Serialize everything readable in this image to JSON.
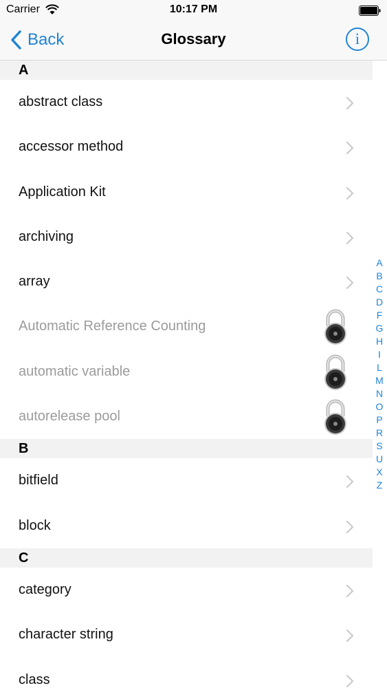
{
  "status_bar": {
    "carrier": "Carrier",
    "time": "10:17 PM"
  },
  "nav": {
    "back_label": "Back",
    "title": "Glossary",
    "info_glyph": "i"
  },
  "colors": {
    "accent": "#1f84d6",
    "locked_text": "#9b9b9b",
    "section_bg": "#f2f2f2"
  },
  "sections": [
    {
      "letter": "A",
      "items": [
        {
          "label": "abstract class",
          "locked": false
        },
        {
          "label": "accessor method",
          "locked": false
        },
        {
          "label": "Application Kit",
          "locked": false
        },
        {
          "label": "archiving",
          "locked": false
        },
        {
          "label": "array",
          "locked": false
        },
        {
          "label": "Automatic Reference Counting",
          "locked": true
        },
        {
          "label": "automatic variable",
          "locked": true
        },
        {
          "label": "autorelease pool",
          "locked": true
        }
      ]
    },
    {
      "letter": "B",
      "items": [
        {
          "label": "bitfield",
          "locked": false
        },
        {
          "label": "block",
          "locked": false
        }
      ]
    },
    {
      "letter": "C",
      "items": [
        {
          "label": "category",
          "locked": false
        },
        {
          "label": "character string",
          "locked": false
        },
        {
          "label": "class",
          "locked": false
        }
      ]
    }
  ],
  "index_letters": [
    "A",
    "B",
    "C",
    "D",
    "F",
    "G",
    "H",
    "I",
    "L",
    "M",
    "N",
    "O",
    "P",
    "R",
    "S",
    "U",
    "X",
    "Z"
  ]
}
